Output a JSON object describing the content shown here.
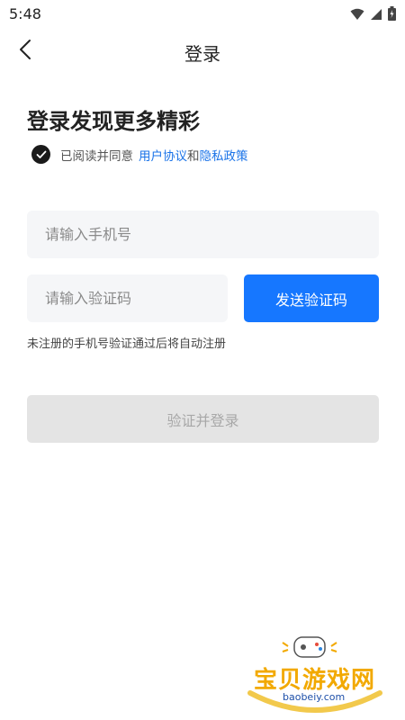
{
  "status_bar": {
    "time": "5:48",
    "icons": [
      "wifi-icon",
      "signal-icon",
      "battery-icon"
    ]
  },
  "nav": {
    "title": "登录",
    "back_icon": "chevron-left-icon"
  },
  "headline": "登录发现更多精彩",
  "agreement": {
    "checked": true,
    "prefix": "已阅读并同意",
    "user_agreement": "用户协议",
    "and": "和",
    "privacy_policy": "隐私政策"
  },
  "phone_input": {
    "placeholder": "请输入手机号",
    "value": ""
  },
  "code_input": {
    "placeholder": "请输入验证码",
    "value": ""
  },
  "send_code_button": "发送验证码",
  "hint": "未注册的手机号验证通过后将自动注册",
  "login_button": "验证并登录",
  "watermark": {
    "text": "宝贝游戏网",
    "url": "baobeiy.com"
  },
  "colors": {
    "accent": "#1677ff",
    "link": "#1a73e8",
    "disabled_bg": "#e4e4e4",
    "input_bg": "#f5f6f8"
  }
}
